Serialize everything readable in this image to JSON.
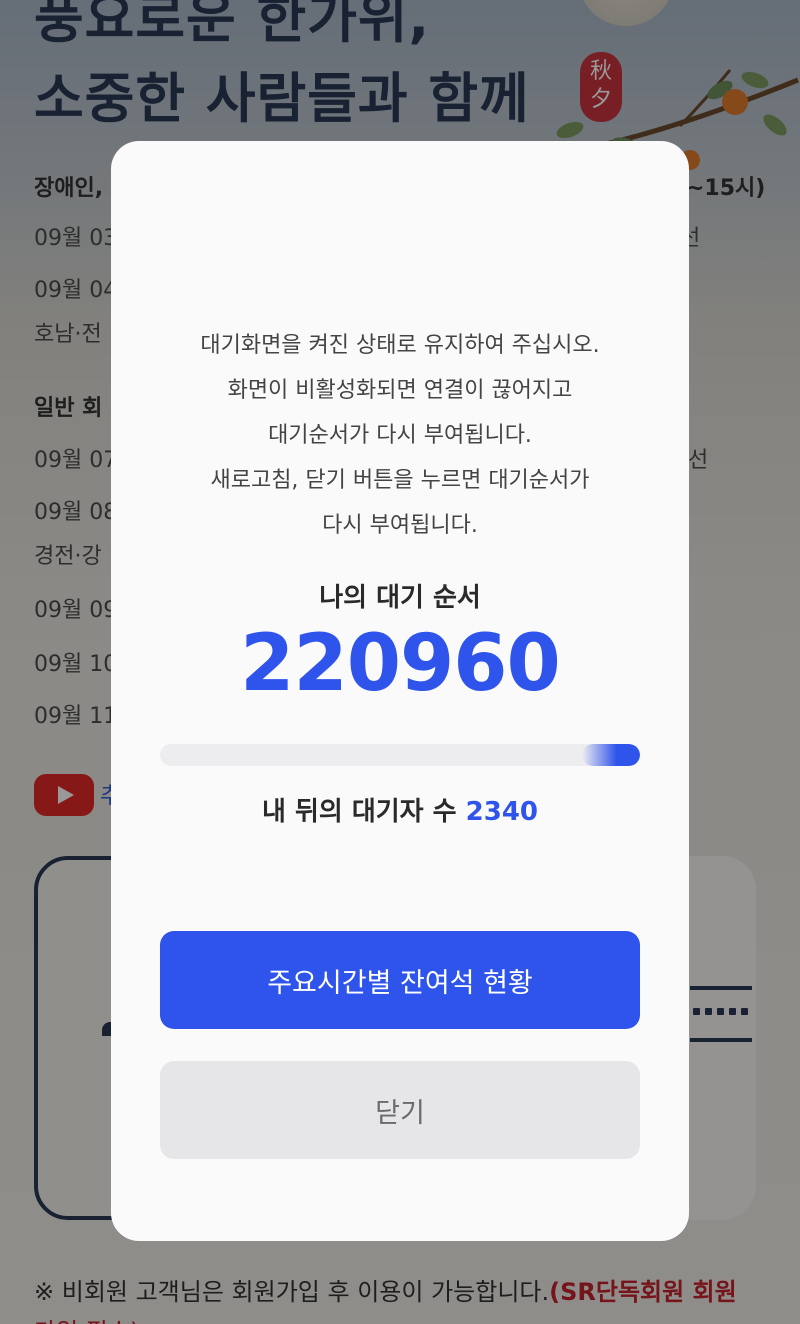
{
  "background": {
    "headline_line1": "풍요로운 한가위,",
    "headline_line2": "소중한 사람들과 함께",
    "seal_text": "秋夕",
    "section_disabled": "장애인,",
    "section_disabled_suffix": "~15시)",
    "row1_prefix": "09월 03",
    "row1_suffix": "선",
    "row2_prefix": "09월 04",
    "row2_sub": "호남·전",
    "section_general": "일반 회",
    "row3_prefix": "09월 07",
    "row3_suffix": "선",
    "row4_prefix": "09월 08",
    "row4_sub": "경전·강",
    "row5_prefix": "09월 09",
    "row6_prefix": "09월 10",
    "row7_prefix": "09월 11",
    "youtube_text": "추",
    "footnote": "※ 비회원 고객님은 회원가입 후 이용이 가능합니다.",
    "footnote_red": "(SR단독회원 회원",
    "footnote_red2": "가입 필수)"
  },
  "modal": {
    "notice_lines": [
      "대기화면을 켜진 상태로 유지하여 주십시오.",
      "화면이 비활성화되면 연결이 끊어지고",
      "대기순서가 다시 부여됩니다.",
      "새로고침, 닫기 버튼을 누르면 대기순서가",
      "다시 부여됩니다."
    ],
    "queue_label": "나의 대기 순서",
    "queue_number": "220960",
    "progress_fraction": 0.12,
    "behind_label": "내 뒤의 대기자 수",
    "behind_count": "2340",
    "primary_button": "주요시간별 잔여석 현황",
    "close_button": "닫기"
  },
  "colors": {
    "accent": "#2f54eb",
    "close_bg": "#e6e6e8",
    "overlay": "rgba(0,0,0,0.40)"
  }
}
